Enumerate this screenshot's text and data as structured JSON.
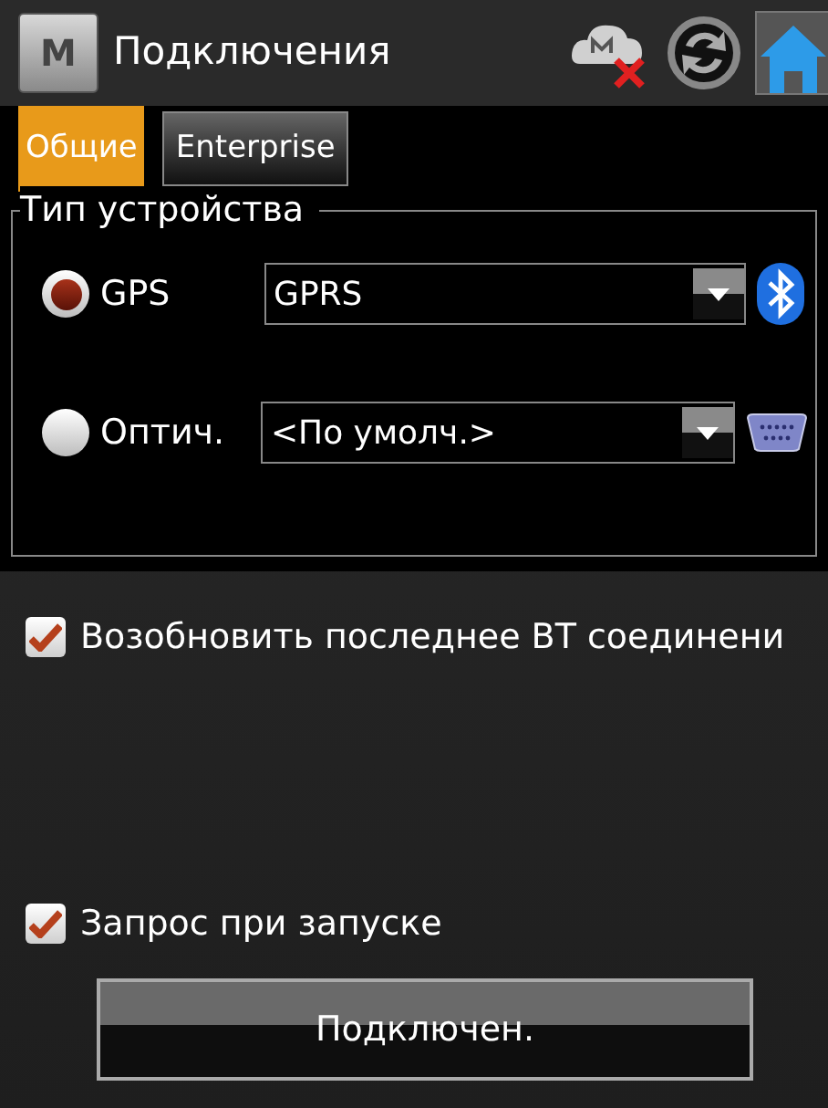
{
  "window": {
    "title": "Подключения",
    "app_letter": "M"
  },
  "tabs": [
    {
      "label": "Общие",
      "selected": true
    },
    {
      "label": "Enterprise",
      "selected": false
    }
  ],
  "device_type": {
    "title": "Тип устройства",
    "options": [
      {
        "label": "GPS",
        "selected": true,
        "value": "GPRS",
        "kind": "bluetooth"
      },
      {
        "label": "Оптич.",
        "selected": false,
        "value": "<По умолч.>",
        "kind": "serial"
      }
    ]
  },
  "checkboxes": [
    {
      "label": "Возобновить последнее BT соединени",
      "checked": true
    },
    {
      "label": "Запрос при запуске",
      "checked": true
    }
  ],
  "connect_button": {
    "label": "Подключен."
  }
}
